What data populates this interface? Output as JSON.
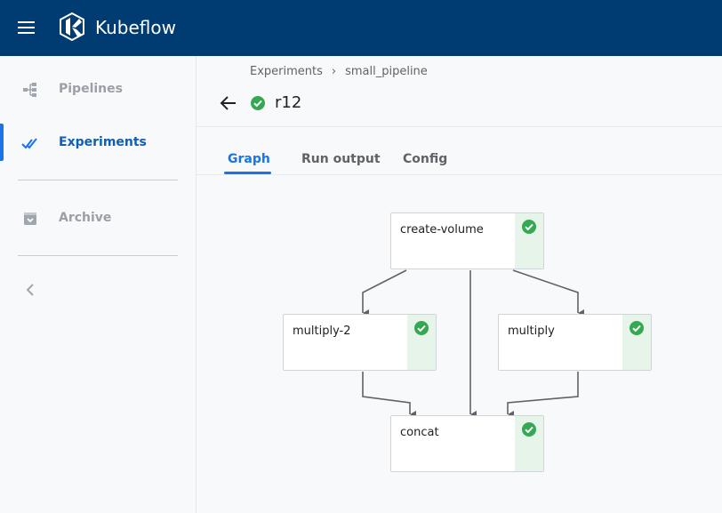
{
  "app": {
    "title": "Kubeflow"
  },
  "sidebar": {
    "items": [
      {
        "label": "Pipelines",
        "icon": "pipelines-icon",
        "active": false
      },
      {
        "label": "Experiments",
        "icon": "experiments-icon",
        "active": true
      },
      {
        "label": "Archive",
        "icon": "archive-icon",
        "active": false
      }
    ]
  },
  "breadcrumb": [
    "Experiments",
    "small_pipeline"
  ],
  "run": {
    "name": "r12",
    "status": "succeeded"
  },
  "tabs": [
    {
      "label": "Graph",
      "active": true
    },
    {
      "label": "Run output",
      "active": false
    },
    {
      "label": "Config",
      "active": false
    }
  ],
  "graph": {
    "nodes": [
      {
        "name": "create-volume",
        "status": "succeeded"
      },
      {
        "name": "multiply-2",
        "status": "succeeded"
      },
      {
        "name": "multiply",
        "status": "succeeded"
      },
      {
        "name": "concat",
        "status": "succeeded"
      }
    ],
    "edges": [
      [
        "create-volume",
        "multiply-2"
      ],
      [
        "create-volume",
        "multiply"
      ],
      [
        "create-volume",
        "concat"
      ],
      [
        "multiply-2",
        "concat"
      ],
      [
        "multiply",
        "concat"
      ]
    ]
  },
  "colors": {
    "topbar": "#003c71",
    "accent": "#1a73e8",
    "success": "#34a853",
    "success_bg": "#e6f4ea"
  }
}
